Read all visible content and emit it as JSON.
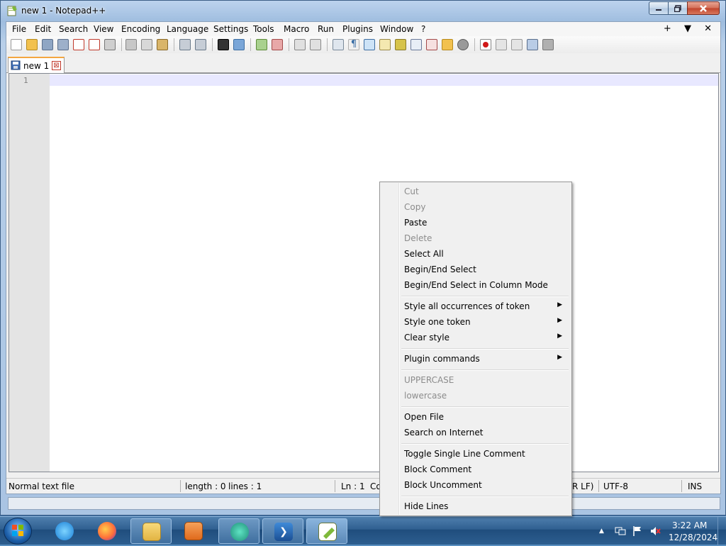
{
  "window": {
    "title": "new 1 - Notepad++"
  },
  "menu": {
    "items": [
      "File",
      "Edit",
      "Search",
      "View",
      "Encoding",
      "Language",
      "Settings",
      "Tools",
      "Macro",
      "Run",
      "Plugins",
      "Window",
      "?"
    ],
    "right_plus": "+",
    "right_down": "▼",
    "right_close": "✕"
  },
  "tab": {
    "label": "new 1",
    "close": "⊠"
  },
  "editor": {
    "line_number": "1"
  },
  "status": {
    "file_type": "Normal text file",
    "length": "length : 0",
    "lines": "lines : 1",
    "ln": "Ln : 1",
    "col_partial": "Co",
    "eol_partial": "R LF)",
    "encoding": "UTF-8",
    "mode": "INS"
  },
  "context_menu": {
    "items": [
      {
        "label": "Cut",
        "enabled": false
      },
      {
        "label": "Copy",
        "enabled": false
      },
      {
        "label": "Paste",
        "enabled": true
      },
      {
        "label": "Delete",
        "enabled": false
      },
      {
        "label": "Select All",
        "enabled": true
      },
      {
        "label": "Begin/End Select",
        "enabled": true
      },
      {
        "label": "Begin/End Select in Column Mode",
        "enabled": true
      },
      {
        "label": "Style all occurrences of token",
        "enabled": true,
        "submenu": true
      },
      {
        "label": "Style one token",
        "enabled": true,
        "submenu": true
      },
      {
        "label": "Clear style",
        "enabled": true,
        "submenu": true
      },
      {
        "label": "Plugin commands",
        "enabled": true,
        "submenu": true
      },
      {
        "label": "UPPERCASE",
        "enabled": false
      },
      {
        "label": "lowercase",
        "enabled": false
      },
      {
        "label": "Open File",
        "enabled": true
      },
      {
        "label": "Search on Internet",
        "enabled": true
      },
      {
        "label": "Toggle Single Line Comment",
        "enabled": true
      },
      {
        "label": "Block Comment",
        "enabled": true
      },
      {
        "label": "Block Uncomment",
        "enabled": true
      },
      {
        "label": "Hide Lines",
        "enabled": true
      }
    ],
    "submenu_arrow": "▶"
  },
  "taskbar": {
    "apps": [
      "internet-explorer",
      "firefox",
      "file-explorer",
      "media-player",
      "app-teal",
      "powershell",
      "notepad-plus-plus"
    ],
    "clock_time": "3:22 AM",
    "clock_date": "12/28/2024",
    "tray_expand": "▲"
  },
  "colors": {
    "accent_tab": "#f4a640",
    "current_line": "#e8e8ff",
    "disabled_text": "#8c8c8c"
  }
}
